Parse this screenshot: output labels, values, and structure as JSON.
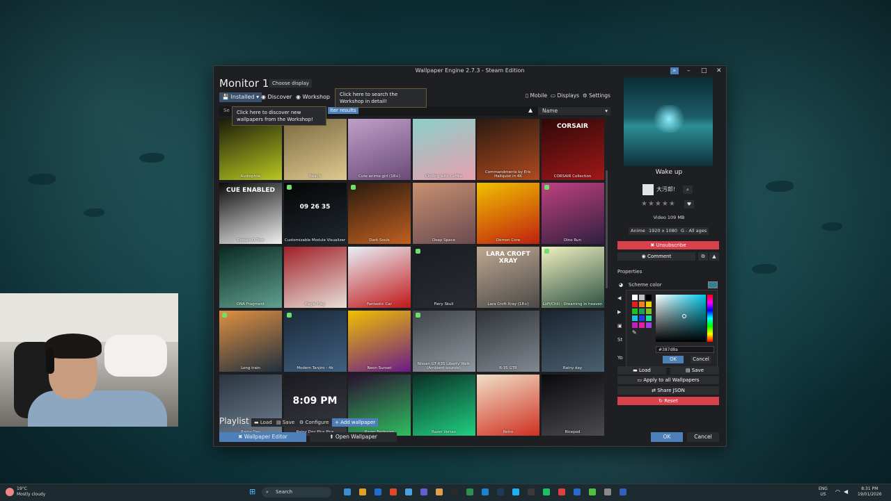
{
  "window": {
    "title": "Wallpaper Engine 2.7.3 - Steam Edition",
    "controls": [
      "»",
      "–",
      "□",
      "✕"
    ]
  },
  "header": {
    "monitor_title": "Monitor 1",
    "choose_display": "Choose display"
  },
  "tabs": [
    {
      "label": "Installed ▾",
      "icon": "save-icon"
    },
    {
      "label": "Discover",
      "icon": "compass-icon"
    },
    {
      "label": "Workshop",
      "icon": "steam-icon"
    }
  ],
  "tooltips": {
    "workshop": "Click here to search the Workshop in detail!",
    "discover": "Click here to discover new wallpapers from the Workshop!"
  },
  "top_right": {
    "mobile": "Mobile",
    "displays": "Displays",
    "settings": "Settings"
  },
  "filter": {
    "search_stub": "Se",
    "filter_results": "lter results",
    "sort_label": "Name"
  },
  "wallpapers": [
    {
      "name": "Audiophile",
      "c1": "#1a1a0a",
      "c2": "#b8c820"
    },
    {
      "name": "Beach",
      "c1": "#7a6a40",
      "c2": "#e0c890"
    },
    {
      "name": "Cute anime girl (18+)",
      "c1": "#c0a0c8",
      "c2": "#6a4a78"
    },
    {
      "name": "Chilling with Coffee",
      "c1": "#8acfc8",
      "c2": "#e8a0b0"
    },
    {
      "name": "Commandments by Eric Hallquist in 4K",
      "c1": "#2a1a10",
      "c2": "#b04a20"
    },
    {
      "name": "CORSAIR Collection",
      "c1": "#300808",
      "c2": "#a01818"
    },
    {
      "name": "Corsair-O-Tron",
      "c1": "#0a0a0a",
      "c2": "#f0f0f0"
    },
    {
      "name": "Customizable Module Visualizer",
      "c1": "#050505",
      "c2": "#202830"
    },
    {
      "name": "Dark Souls",
      "c1": "#2a1a10",
      "c2": "#c06020"
    },
    {
      "name": "Deep Space",
      "c1": "#c89070",
      "c2": "#6a4a50"
    },
    {
      "name": "Demon Core",
      "c1": "#f0c000",
      "c2": "#c02010"
    },
    {
      "name": "Dino Run",
      "c1": "#c04080",
      "c2": "#302040"
    },
    {
      "name": "DNA Fragment",
      "c1": "#0a2a20",
      "c2": "#60a090"
    },
    {
      "name": "Eagle Flag",
      "c1": "#a02028",
      "c2": "#e8e0d8"
    },
    {
      "name": "Fantastic Car",
      "c1": "#e8f0f8",
      "c2": "#c01818"
    },
    {
      "name": "Fiery Skull",
      "c1": "#1a1c22",
      "c2": "#2a2c34"
    },
    {
      "name": "Lara Croft Xray (18+)",
      "c1": "#c0a890",
      "c2": "#4a4a48"
    },
    {
      "name": "LoFi/Chill - Dreaming in heaven",
      "c1": "#f0f0c0",
      "c2": "#2a5040"
    },
    {
      "name": "Long train",
      "c1": "#e09040",
      "c2": "#203040"
    },
    {
      "name": "Modern Tanjiro - 4k",
      "c1": "#1a2a3a",
      "c2": "#406080"
    },
    {
      "name": "Neon Sunset",
      "c1": "#f0c000",
      "c2": "#6a1a8a"
    },
    {
      "name": "Nissan GT-R35 Liberty Walk (Ambient sounds)",
      "c1": "#404448",
      "c2": "#9098a0"
    },
    {
      "name": "R-35 GTR",
      "c1": "#303438",
      "c2": "#808890"
    },
    {
      "name": "Rainy day",
      "c1": "#1a2430",
      "c2": "#4a6070"
    },
    {
      "name": "Rainy Day",
      "c1": "#2a3440",
      "c2": "#708090"
    },
    {
      "name": "Rainy Day Plus Plus",
      "c1": "#1a1a20",
      "c2": "#3a3a44"
    },
    {
      "name": "Razer Bedroom",
      "c1": "#2a1030",
      "c2": "#30c060"
    },
    {
      "name": "Razer Vortex",
      "c1": "#0a3028",
      "c2": "#20d080"
    },
    {
      "name": "Retro",
      "c1": "#f0e0c8",
      "c2": "#d03020"
    },
    {
      "name": "Ricepod",
      "c1": "#0a0a0c",
      "c2": "#4a4a50"
    }
  ],
  "tile_overlays": {
    "cue": "CUE ENABLED",
    "clock": "09 26 35",
    "clock2": "8:09 PM",
    "lara": "LARA CROFT XRAY",
    "corsair": "CORSAIR",
    "badge18": "18+"
  },
  "playlist": {
    "title": "Playlist",
    "load": "Load",
    "save": "Save",
    "configure": "Configure",
    "add": "+ Add wallpaper"
  },
  "bottom": {
    "editor": "Wallpaper Editor",
    "open": "Open Wallpaper",
    "ok": "OK",
    "cancel": "Cancel"
  },
  "details": {
    "name": "Wake up",
    "author": "大污郎!",
    "stars": "★★★★★",
    "type_size": "Video 109 MB",
    "tags": [
      "Anime",
      "1920 x 1080",
      "G - All ages"
    ],
    "unsubscribe": "✖ Unsubscribe",
    "comment": "Comment",
    "properties": "Properties",
    "scheme_color": "Scheme color",
    "scheme_hex": "#387d8a"
  },
  "picker": {
    "hex": "#387d8a",
    "ok": "OK",
    "cancel": "Cancel",
    "swatches": [
      "#ffffff",
      "#c0c0c0",
      "#000000",
      "#e02020",
      "#f08020",
      "#f0d000",
      "#20c020",
      "#20a060",
      "#80c020",
      "#20c0e0",
      "#2040e0",
      "#20e0a0",
      "#c020c0",
      "#e020a0",
      "#a040e0"
    ]
  },
  "side_labels": {
    "st": "St",
    "yo": "Yo"
  },
  "actions": {
    "load": "Load",
    "save": "Save",
    "apply_all": "Apply to all Wallpapers",
    "share": "Share JSON",
    "reset": "Reset"
  },
  "taskbar": {
    "weather_temp": "19°C",
    "weather_desc": "Mostly cloudy",
    "search": "Search",
    "lang": "ENG",
    "region": "US",
    "time": "8:31 PM",
    "date": "19/01/2026"
  }
}
